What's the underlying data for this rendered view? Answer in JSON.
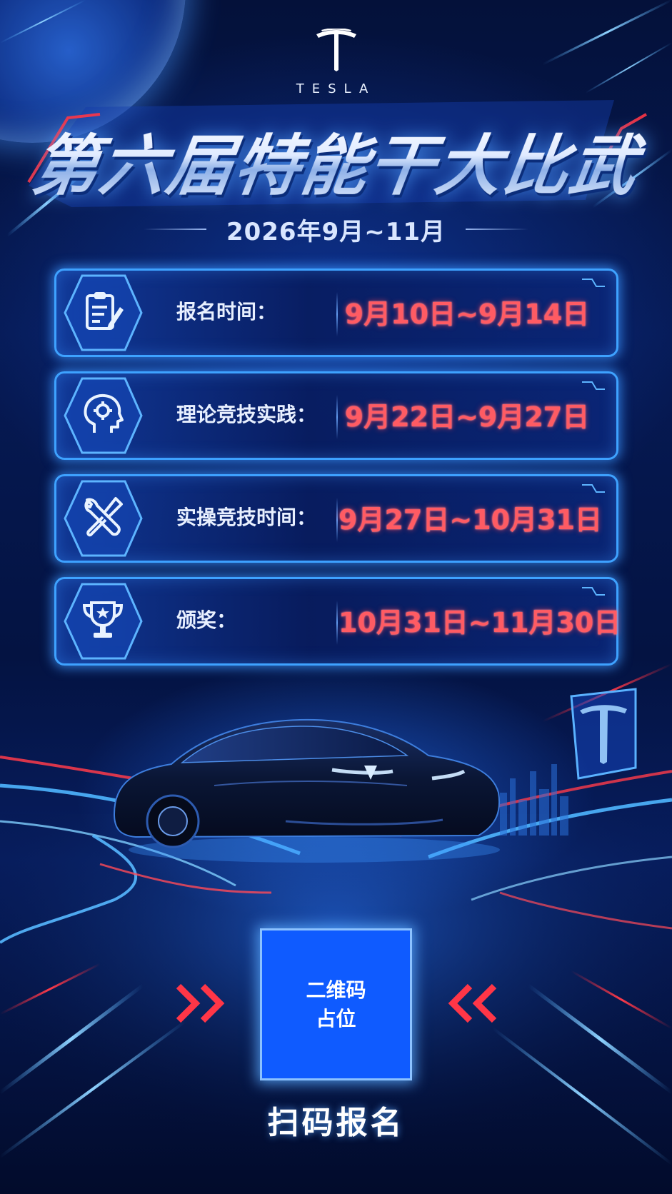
{
  "header": {
    "brand": "TESLA",
    "title": "第六届特能干大比武",
    "date_range": "2026年9月~11月"
  },
  "schedule": [
    {
      "icon": "clipboard-icon",
      "label": "报名时间：",
      "value": "9月10日~9月14日"
    },
    {
      "icon": "brain-gear-icon",
      "label": "理论竞技实践：",
      "value": "9月22日~9月27日"
    },
    {
      "icon": "tools-icon",
      "label": "实操竞技时间：",
      "value": "9月27日~10月31日"
    },
    {
      "icon": "trophy-icon",
      "label": "颁奖：",
      "value": "10月31日~11月30日"
    }
  ],
  "qr": {
    "line1": "二维码",
    "line2": "占位"
  },
  "cta": "扫码报名",
  "colors": {
    "accent_blue": "#3ea2ff",
    "value_red": "#ff5b63",
    "qr_fill": "#0f5bff",
    "background": "#061a55"
  }
}
